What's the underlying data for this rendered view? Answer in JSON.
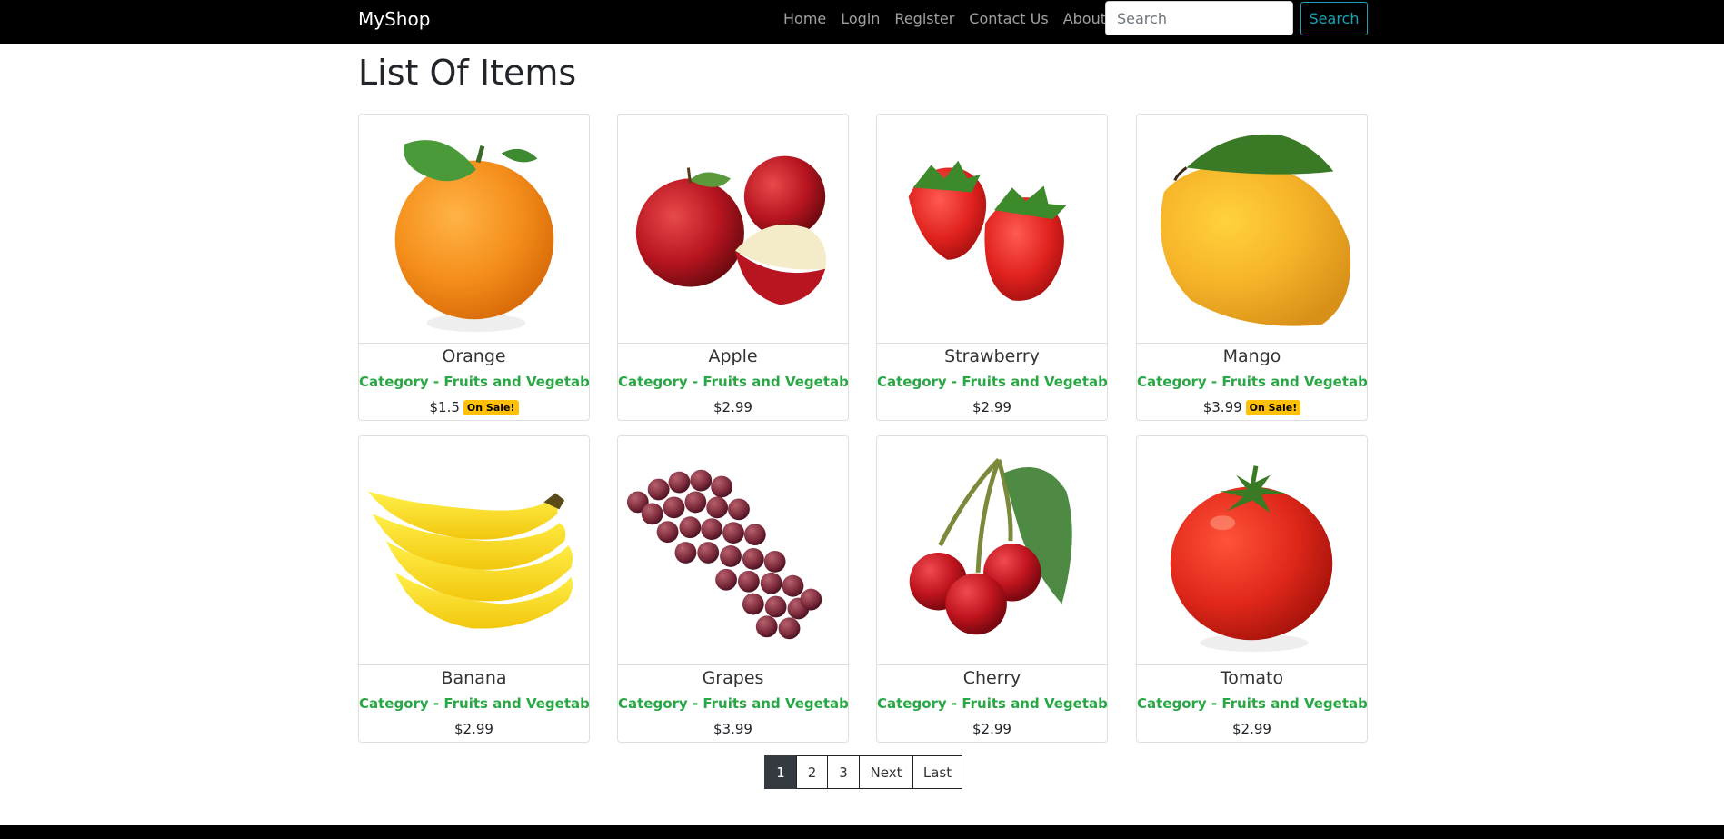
{
  "navbar": {
    "brand": "MyShop",
    "links": [
      "Home",
      "Login",
      "Register",
      "Contact Us",
      "About Us"
    ],
    "search_placeholder": "Search",
    "search_button": "Search"
  },
  "page": {
    "title": "List Of Items"
  },
  "items": [
    {
      "name": "Orange",
      "category": "Category - Fruits and Vegetables",
      "price": "$1.5",
      "badge": "On Sale!",
      "image": "orange"
    },
    {
      "name": "Apple",
      "category": "Category - Fruits and Vegetables",
      "price": "$2.99",
      "badge": "",
      "image": "apple"
    },
    {
      "name": "Strawberry",
      "category": "Category - Fruits and Vegetables",
      "price": "$2.99",
      "badge": "",
      "image": "strawberry"
    },
    {
      "name": "Mango",
      "category": "Category - Fruits and Vegetables",
      "price": "$3.99",
      "badge": "On Sale!",
      "image": "mango"
    },
    {
      "name": "Banana",
      "category": "Category - Fruits and Vegetables",
      "price": "$2.99",
      "badge": "",
      "image": "banana"
    },
    {
      "name": "Grapes",
      "category": "Category - Fruits and Vegetables",
      "price": "$3.99",
      "badge": "",
      "image": "grapes"
    },
    {
      "name": "Cherry",
      "category": "Category - Fruits and Vegetables",
      "price": "$2.99",
      "badge": "",
      "image": "cherry"
    },
    {
      "name": "Tomato",
      "category": "Category - Fruits and Vegetables",
      "price": "$2.99",
      "badge": "",
      "image": "tomato"
    }
  ],
  "pagination": {
    "pages": [
      "1",
      "2",
      "3",
      "Next",
      "Last"
    ],
    "active": "1"
  }
}
